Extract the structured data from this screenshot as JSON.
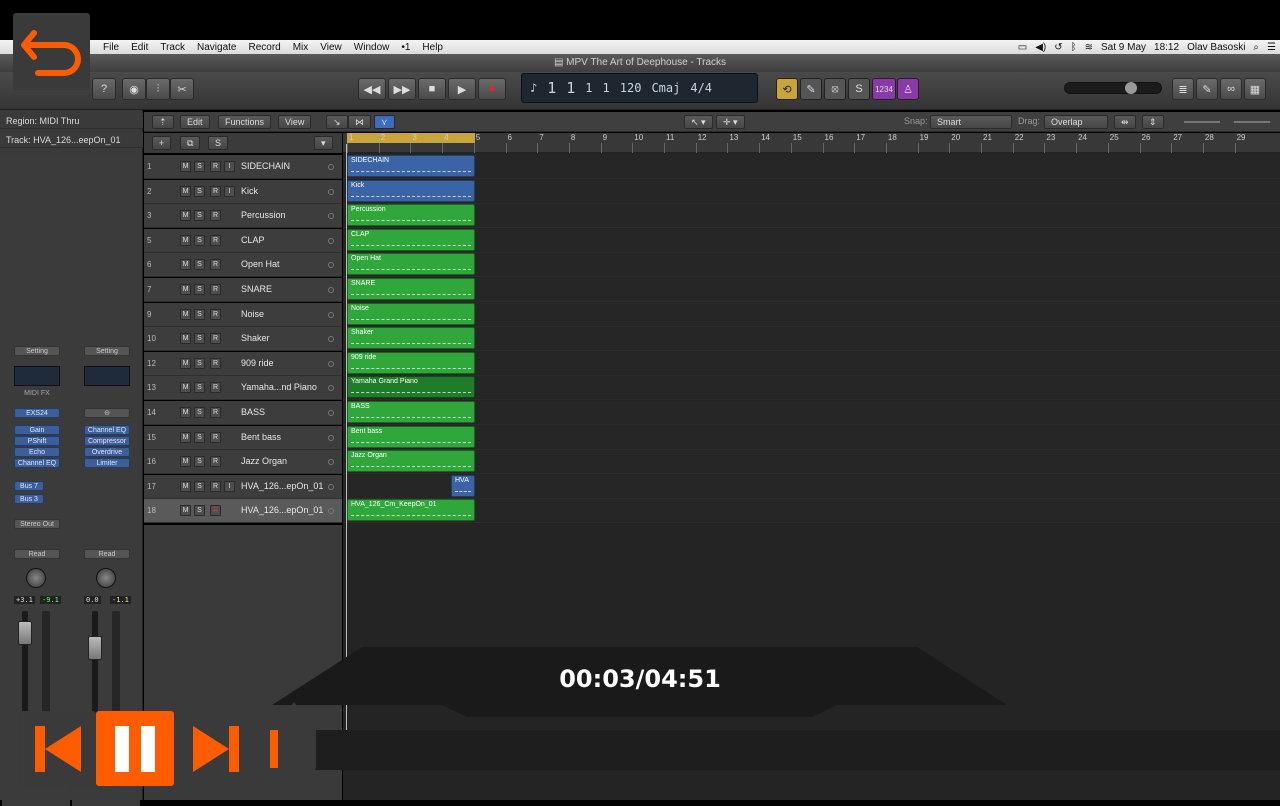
{
  "menubar": {
    "menus": [
      "File",
      "Edit",
      "Track",
      "Navigate",
      "Record",
      "Mix",
      "View",
      "Window",
      "•1",
      "Help"
    ],
    "date": "Sat 9 May",
    "time": "18:12",
    "user": "Olav Basoski"
  },
  "window": {
    "title": "MPV The Art of Deephouse - Tracks"
  },
  "lcd": {
    "bar": "1",
    "beat": "1",
    "div": "1",
    "tick": "1",
    "tempo": "120",
    "key": "Cmaj",
    "signature": "4/4",
    "cpu": "1234"
  },
  "inspector": {
    "region_label": "Region: MIDI Thru",
    "track_label": "Track: HVA_126...eepOn_01",
    "strip1": {
      "setting": "Setting",
      "midi_fx": "MIDI FX",
      "instrument": "EXS24",
      "plugins": [
        "Gain",
        "PShift",
        "Echo",
        "Channel EQ"
      ],
      "sends": [
        "Bus 7",
        "Bus 3"
      ],
      "output": "Stereo Out",
      "automation": "Read",
      "pan_readout": "+3.1",
      "level_readout": "-9.1"
    },
    "strip2": {
      "setting": "Setting",
      "plugins": [
        "Channel EQ",
        "Compressor",
        "Overdrive",
        "Limiter"
      ],
      "automation": "Read",
      "pan_readout": "0.0",
      "level_readout": "-1.1"
    }
  },
  "toolbar": {
    "edit": "Edit",
    "functions": "Functions",
    "view": "View",
    "snap_label": "Snap:",
    "snap_value": "Smart",
    "drag_label": "Drag:",
    "drag_value": "Overlap"
  },
  "ruler": [
    "1",
    "2",
    "3",
    "4",
    "5",
    "6",
    "7",
    "8",
    "9",
    "10",
    "11",
    "12",
    "13",
    "14",
    "15",
    "16",
    "17",
    "18",
    "19",
    "20",
    "21",
    "22",
    "23",
    "24",
    "25",
    "26",
    "27",
    "28",
    "29"
  ],
  "tracks": [
    {
      "num": "1",
      "name": "SIDECHAIN",
      "input": true,
      "region": "SIDECHAIN",
      "color": "#3a64a6"
    },
    {
      "num": "2",
      "name": "Kick",
      "input": true,
      "region": "Kick",
      "color": "#3a64a6"
    },
    {
      "num": "3",
      "name": "Percussion",
      "input": false,
      "region": "Percussion",
      "color": "#2fa73a"
    },
    {
      "num": "5",
      "name": "CLAP",
      "input": false,
      "region": "CLAP",
      "color": "#2fa73a"
    },
    {
      "num": "6",
      "name": "Open Hat",
      "input": false,
      "region": "Open Hat",
      "color": "#2fa73a"
    },
    {
      "num": "7",
      "name": "SNARE",
      "input": false,
      "region": "SNARE",
      "color": "#2fa73a"
    },
    {
      "num": "9",
      "name": "Noise",
      "input": false,
      "region": "Noise",
      "color": "#2fa73a"
    },
    {
      "num": "10",
      "name": "Shaker",
      "input": false,
      "region": "Shaker",
      "color": "#2fa73a"
    },
    {
      "num": "12",
      "name": "909 ride",
      "input": false,
      "region": "909 ride",
      "color": "#2fa73a"
    },
    {
      "num": "13",
      "name": "Yamaha...nd Piano",
      "input": false,
      "region": "Yamaha Grand Piano",
      "color": "#1f7d2a"
    },
    {
      "num": "14",
      "name": "BASS",
      "input": false,
      "region": "BASS",
      "color": "#2fa73a"
    },
    {
      "num": "15",
      "name": "Bent bass",
      "input": false,
      "region": "Bent bass",
      "color": "#2fa73a"
    },
    {
      "num": "16",
      "name": "Jazz Organ",
      "input": false,
      "region": "Jazz Organ",
      "color": "#2fa73a"
    },
    {
      "num": "17",
      "name": "HVA_126...epOn_01",
      "input": true,
      "region": "HVA",
      "color": "#3a64a6"
    },
    {
      "num": "18",
      "name": "HVA_126...epOn_01",
      "input": false,
      "region": "HVA_126_Cm_KeepOn_01",
      "color": "#2fa73a"
    }
  ],
  "player": {
    "time": "00:03/04:51",
    "progress": 0.01
  },
  "colors": {
    "accent": "#ff5c00",
    "midi_region": "#2fa73a",
    "audio_region": "#3a64a6",
    "cycle": "#c8a43a"
  }
}
